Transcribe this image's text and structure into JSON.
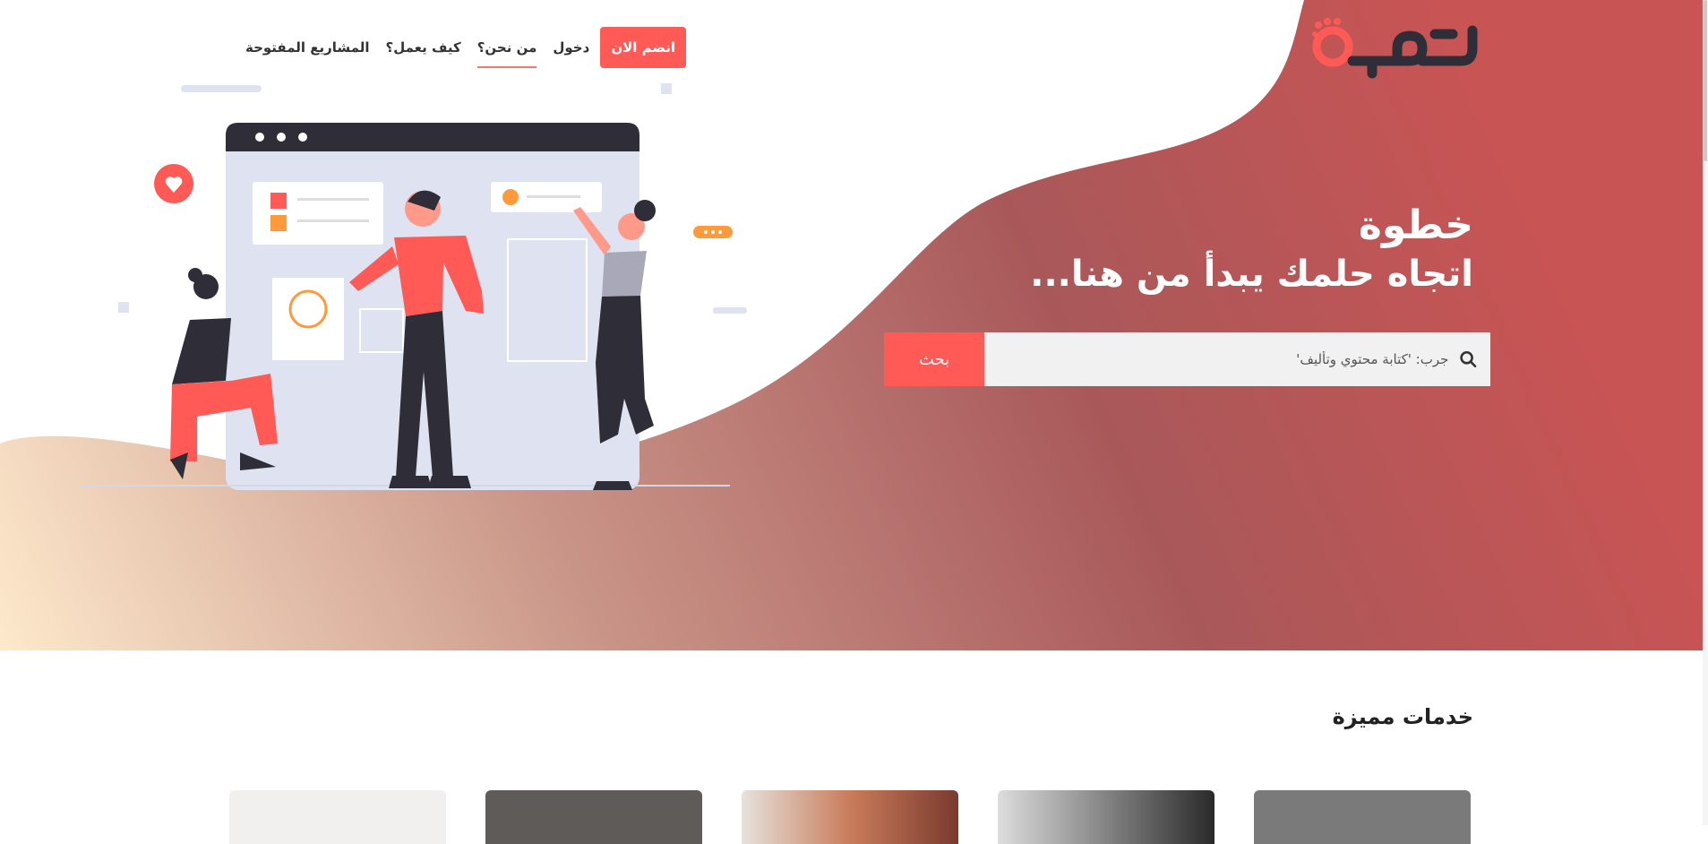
{
  "brand": {
    "logo_text": "خطوة"
  },
  "nav": {
    "items": [
      {
        "label": "المشاريع المفتوحة"
      },
      {
        "label": "كيف يعمل؟"
      },
      {
        "label": "من نحن؟"
      },
      {
        "label": "دخول"
      }
    ],
    "join_label": "انضم الان"
  },
  "hero": {
    "title": "خطوة",
    "subtitle": "اتجاه حلمك يبدأ من هنا...",
    "search": {
      "placeholder": "جرب: 'كتابة محتوي وتأليف'",
      "button_label": "بحث",
      "icon": "search-icon"
    }
  },
  "services": {
    "title": "خدمات مميزة"
  },
  "colors": {
    "accent": "#ff5a55",
    "hero_dark": "#a8585a",
    "hero_light": "#fbe6c9",
    "text": "#222222"
  }
}
